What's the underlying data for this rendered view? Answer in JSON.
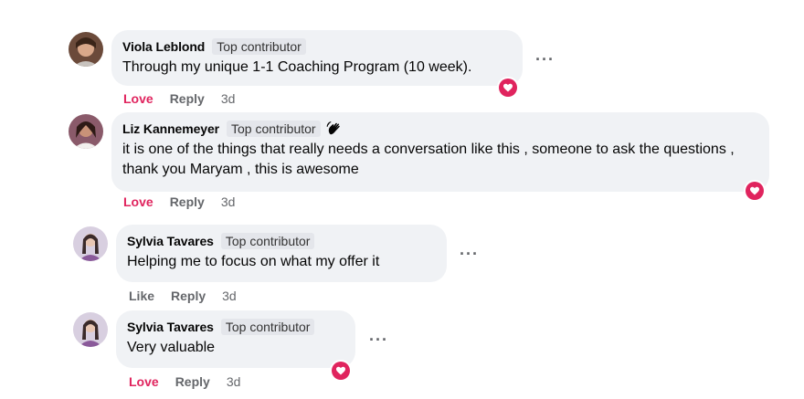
{
  "comments": [
    {
      "author": "Viola Leblond",
      "badge": "Top contributor",
      "text": "Through my unique 1-1 Coaching Program (10 week).",
      "actions": {
        "react": "Love",
        "reply": "Reply",
        "time": "3d"
      },
      "reaction": "heart-icon"
    },
    {
      "author": "Liz Kannemeyer",
      "badge": "Top contributor",
      "text": "it is one of the things that really needs a conversation like this , someone to ask the questions , thank you Maryam , this is awesome",
      "actions": {
        "react": "Love",
        "reply": "Reply",
        "time": "3d"
      },
      "reaction": "heart-icon"
    },
    {
      "author": "Sylvia Tavares",
      "badge": "Top contributor",
      "text": "Helping me to focus on what my offer it",
      "actions": {
        "react": "Like",
        "reply": "Reply",
        "time": "3d"
      }
    },
    {
      "author": "Sylvia Tavares",
      "badge": "Top contributor",
      "text": "Very valuable",
      "actions": {
        "react": "Love",
        "reply": "Reply",
        "time": "3d"
      },
      "reaction": "heart-icon"
    }
  ],
  "more_label": "···",
  "colors": {
    "love": "#e0245e",
    "bubble": "#f0f2f5",
    "meta": "#65676b"
  }
}
